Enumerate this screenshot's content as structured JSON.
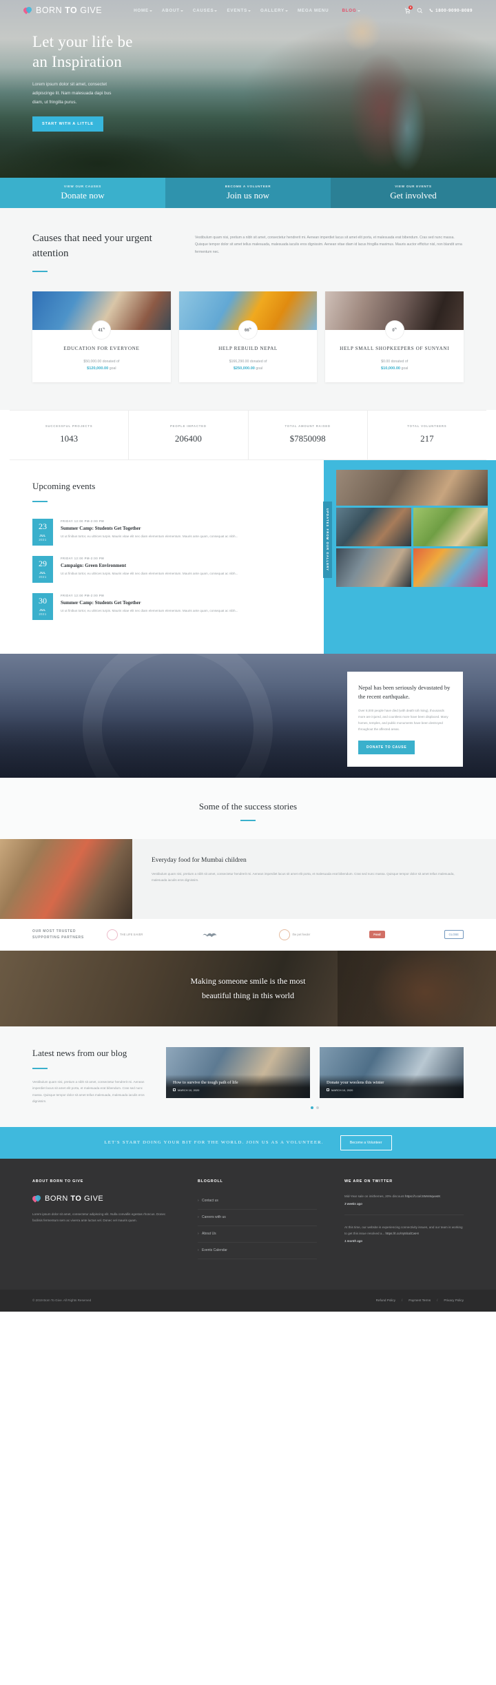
{
  "header": {
    "logo": {
      "part1": "BORN",
      "part2": "TO",
      "part3": "GIVE"
    },
    "nav": [
      {
        "label": "HOME",
        "caret": true
      },
      {
        "label": "ABOUT",
        "caret": true
      },
      {
        "label": "CAUSES",
        "caret": true
      },
      {
        "label": "EVENTS",
        "caret": true
      },
      {
        "label": "GALLERY",
        "caret": true
      },
      {
        "label": "MEGA MENU",
        "caret": false
      },
      {
        "label": "BLOG",
        "caret": true
      }
    ],
    "cart_badge": "0",
    "phone": "1800-9090-8089"
  },
  "hero": {
    "title_line1": "Let your life be",
    "title_line2": "an Inspiration",
    "paragraph": "Lorem ipsum dolor sit amet, consectet adipiscinge lit. Nam malesuada dapi bus diam, ut fringilla purus.",
    "button": "START WITH A LITTLE"
  },
  "strip": [
    {
      "kicker": "VIEW OUR CAUSES",
      "value": "Donate now"
    },
    {
      "kicker": "BECOME A VOLUNTEER",
      "value": "Join us now"
    },
    {
      "kicker": "VIEW OUR EVENTS",
      "value": "Get involved"
    }
  ],
  "causes": {
    "title": "Causes that need your urgent attention",
    "description": "Vestibulum quam nisi, pretium a nibh sit amet, consectetur hendrerit mi. Aenean imperdiet lacus sit amet elit porta, et malesuada erat bibendum. Cras sed nunc massa. Quisque tempor dolor sit amet tellus malesuada, malesuada iaculis eros dignissim. Aenean vitae diam id lacus fringilla maximus. Mauris auctor efficitur nisl, non blandit urna fermentum nec.",
    "cards": [
      {
        "percent": "41",
        "pct_sign": "%",
        "title": "EDUCATION FOR EVERYONE",
        "donated": "$50,000.00 donated of",
        "goal": "$120,000.00",
        "goal_label": "goal"
      },
      {
        "percent": "66",
        "pct_sign": "%",
        "title": "HELP REBUILD NEPAL",
        "donated": "$166,290.00 donated of",
        "goal": "$250,000.00",
        "goal_label": "goal"
      },
      {
        "percent": "0",
        "pct_sign": "%",
        "title": "HELP SMALL SHOPKEEPERS OF SUNYANI",
        "donated": "$0.00 donated of",
        "goal": "$10,000.00",
        "goal_label": "goal"
      }
    ]
  },
  "stats": [
    {
      "label": "SUCCESSFUL PROJECTS",
      "value": "1043"
    },
    {
      "label": "PEOPLE IMPACTED",
      "value": "206400"
    },
    {
      "label": "TOTAL AMOUNT RAISED",
      "value": "$7850098"
    },
    {
      "label": "TOTAL VOLUNTEERS",
      "value": "217"
    }
  ],
  "events": {
    "title": "Upcoming events",
    "gallery_tab": "UPDATES FROM OUR GALLERY",
    "items": [
      {
        "day": "23",
        "month": "JUL",
        "year": "2021",
        "time": "FRIDAY 12:00 PM-2:00 PM",
        "title": "Summer Camp: Students Get Together",
        "text": "Ut ut finibus tortor, eu ultrices turpis. Mauris vitae elit nec diam elementum elementum. Mauris ante quam, consequat ac nibh..."
      },
      {
        "day": "29",
        "month": "JUL",
        "year": "2021",
        "time": "FRIDAY 12:00 PM-2:00 PM",
        "title": "Campaign: Green Environment",
        "text": "Ut ut finibus tortor, eu ultrices turpis. Mauris vitae elit nec diam elementum elementum. Mauris ante quam, consequat ac nibh..."
      },
      {
        "day": "30",
        "month": "JUL",
        "year": "2021",
        "time": "FRIDAY 12:00 PM-2:00 PM",
        "title": "Summer Camp: Students Get Together",
        "text": "Ut ut finibus tortor, eu ultrices turpis. Mauris vitae elit nec diam elementum elementum. Mauris ante quam, consequat ac nibh..."
      }
    ]
  },
  "nepal": {
    "title": "Nepal has been seriously devastated by the recent earthquake.",
    "text": "Over 8,000 people have died (with death toll rising), thousands more are injured, and countless more have been displaced. Many homes, temples, and public monuments have been destroyed throughout the affected areas.",
    "button": "DONATE TO CAUSE"
  },
  "stories": {
    "title": "Some of the success stories",
    "story_title": "Everyday food for Mumbai children",
    "story_text": "Vestibulum quam nisi, pretium a nibh sit amet, consectetur hendrerit mi. Aenean imperdiet lacus sit amet elit porta, et malesuada erat bibendum. Cras sed nunc massa. Quisque tempor dolor sit amet tellus malesuada, malesuada iaculis eros dignissim."
  },
  "partners": {
    "title": "OUR MOST TRUSTED SUPPORTING PARTNERS",
    "logos": [
      {
        "name": "THE LIFE SAVER"
      },
      {
        "name": ""
      },
      {
        "name": "the pet feeder"
      },
      {
        "name": "Food"
      },
      {
        "name": "GLOBE"
      }
    ]
  },
  "quote": {
    "line1": "Making someone smile is the most",
    "line2": "beautiful thing in this world"
  },
  "blog": {
    "title": "Latest news from our blog",
    "text": "Vestibulum quam nisi, pretium a nibh sit amet, consectetur hendrerit mi. Aenean imperdiet lacus sit amet elit porta, et malesuada erat bibendum. Cras sed nunc massa. Quisque tempor dolor sit amet tellus malesuada, malesuada iaculis eros dignissim.",
    "posts": [
      {
        "title": "How to survive the tough path of life",
        "date": "MARCH 10, 2020"
      },
      {
        "title": "Donate your woolens this winter",
        "date": "MARCH 10, 2020"
      }
    ]
  },
  "cta": {
    "text": "LET'S START DOING YOUR BIT FOR THE WORLD. JOIN US AS A VOLUNTEER.",
    "button": "Become a Volunteer"
  },
  "footer": {
    "about_heading": "ABOUT BORN TO GIVE",
    "about_text": "Lorem ipsum dolor sit amet, consectetur adipiscing elit. Nulla convallis egestas rhoncus. Donec facilisis fermentum sem ac viverra ante luctus vel. Donec vel mauris quam.",
    "blogroll_heading": "BLOGROLL",
    "blogroll": [
      "Contact us",
      "Careers with us",
      "About Us",
      "Events Calendar"
    ],
    "twitter_heading": "WE ARE ON TWITTER",
    "tweets": [
      {
        "text": "Mid-Year sale on imithemes, 20% discount ",
        "link": "https://t.co/cSMm9qwwtK",
        "ago": "3 weeks ago"
      },
      {
        "text": "At this time, our website is experiencing connectivity issues, and our team is working to get this issue resolved a... ",
        "link": "https://t.co/Vy5lUdCwHI",
        "ago": "1 month ago"
      }
    ],
    "copyright": "© 2019 Born To Give. All Rights Reserved",
    "links": [
      "Refund Policy",
      "Payment Terms",
      "Privacy Policy"
    ]
  }
}
